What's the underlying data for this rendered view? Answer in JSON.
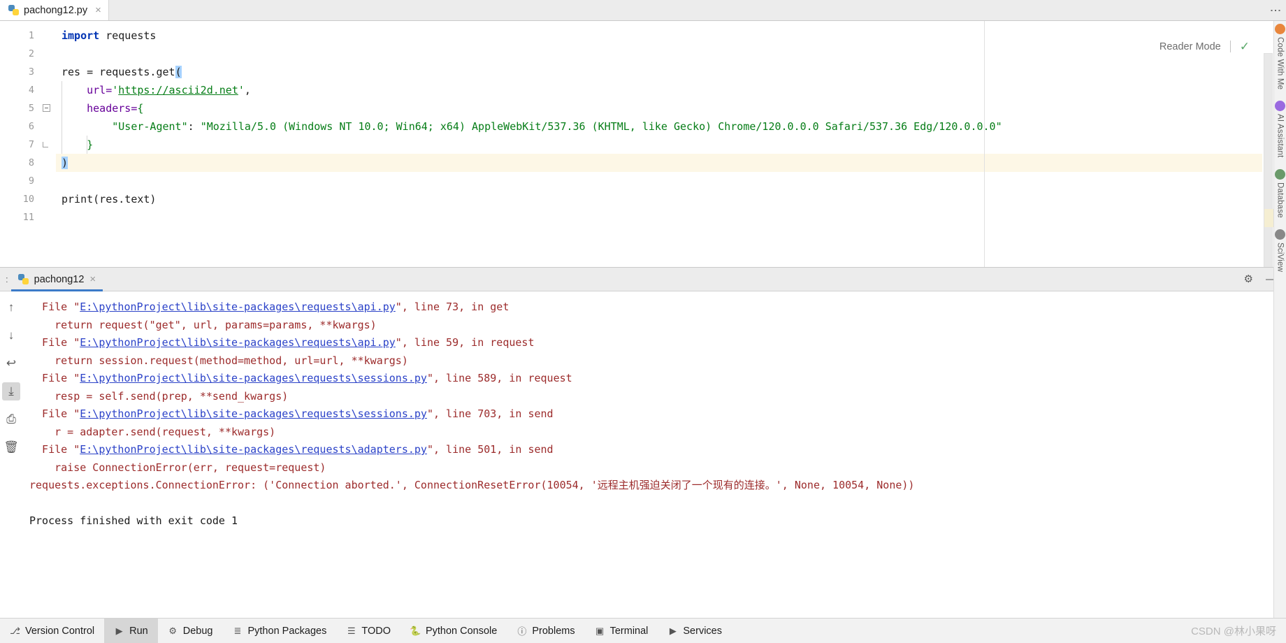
{
  "editor": {
    "tab": {
      "label": "pachong12.py",
      "icon": "python-file-icon",
      "close": "×"
    },
    "overflow_icon": "more-options-icon",
    "reader_mode": {
      "label": "Reader Mode",
      "check_icon": "checkmark-icon"
    },
    "line_numbers": [
      "1",
      "2",
      "3",
      "4",
      "5",
      "6",
      "7",
      "8",
      "9",
      "10",
      "11"
    ],
    "code_lines": [
      {
        "n": 1,
        "tokens": [
          {
            "t": "import ",
            "c": "k"
          },
          {
            "t": "requests",
            "c": "plain"
          }
        ]
      },
      {
        "n": 2,
        "tokens": []
      },
      {
        "n": 3,
        "tokens": [
          {
            "t": "res = requests.get",
            "c": "plain"
          },
          {
            "t": "(",
            "c": "sel-paren"
          }
        ]
      },
      {
        "n": 4,
        "tokens": [
          {
            "t": "    url=",
            "c": "param"
          },
          {
            "t": "'",
            "c": "str"
          },
          {
            "t": "https://ascii2d.net",
            "c": "url"
          },
          {
            "t": "'",
            "c": "str"
          },
          {
            "t": ",",
            "c": "plain"
          }
        ]
      },
      {
        "n": 5,
        "tokens": [
          {
            "t": "    headers=",
            "c": "param"
          },
          {
            "t": "{",
            "c": "brace"
          }
        ]
      },
      {
        "n": 6,
        "tokens": [
          {
            "t": "        \"User-Agent\"",
            "c": "str"
          },
          {
            "t": ": ",
            "c": "plain"
          },
          {
            "t": "\"Mozilla/5.0 (Windows NT 10.0; Win64; x64) AppleWebKit/537.36 (KHTML, like Gecko) Chrome/120.0.0.0 Safari/537.36 Edg/120.0.0.0\"",
            "c": "str"
          }
        ]
      },
      {
        "n": 7,
        "tokens": [
          {
            "t": "    }",
            "c": "brace"
          }
        ]
      },
      {
        "n": 8,
        "tokens": [
          {
            "t": ")",
            "c": "sel-paren"
          }
        ],
        "current": true
      },
      {
        "n": 9,
        "tokens": []
      },
      {
        "n": 10,
        "tokens": [
          {
            "t": "print",
            "c": "fn"
          },
          {
            "t": "(res.text)",
            "c": "plain"
          }
        ]
      },
      {
        "n": 11,
        "tokens": []
      }
    ]
  },
  "right_strip": {
    "items": [
      {
        "label": "Code With Me",
        "icon": "codewithme-icon"
      },
      {
        "label": "AI Assistant",
        "icon": "ai-assistant-icon"
      },
      {
        "label": "Database",
        "icon": "database-icon"
      },
      {
        "label": "SciView",
        "icon": "sciview-icon"
      }
    ]
  },
  "run_window": {
    "prefix": ":",
    "tab": {
      "label": "pachong12",
      "icon": "python-run-icon",
      "close": "×"
    },
    "settings_icon": "gear-icon",
    "minimize_icon": "minimize-icon",
    "sidebar_buttons": [
      {
        "name": "up-arrow-icon",
        "glyph": "↑"
      },
      {
        "name": "down-arrow-icon",
        "glyph": "↓"
      },
      {
        "name": "soft-wrap-icon",
        "glyph": "↩"
      },
      {
        "name": "scroll-to-end-icon",
        "glyph": "⤓",
        "selected": true
      },
      {
        "name": "print-icon",
        "glyph": "⎙"
      },
      {
        "name": "trash-icon",
        "glyph": "🗑"
      }
    ],
    "output": [
      {
        "parts": [
          {
            "t": "  File \"",
            "c": "err"
          },
          {
            "t": "E:\\pythonProject\\lib\\site-packages\\requests\\api.py",
            "c": "lnk"
          },
          {
            "t": "\", line 73, in get",
            "c": "err"
          }
        ]
      },
      {
        "parts": [
          {
            "t": "    return request(\"get\", url, params=params, **kwargs)",
            "c": "err"
          }
        ]
      },
      {
        "parts": [
          {
            "t": "  File \"",
            "c": "err"
          },
          {
            "t": "E:\\pythonProject\\lib\\site-packages\\requests\\api.py",
            "c": "lnk"
          },
          {
            "t": "\", line 59, in request",
            "c": "err"
          }
        ]
      },
      {
        "parts": [
          {
            "t": "    return session.request(method=method, url=url, **kwargs)",
            "c": "err"
          }
        ]
      },
      {
        "parts": [
          {
            "t": "  File \"",
            "c": "err"
          },
          {
            "t": "E:\\pythonProject\\lib\\site-packages\\requests\\sessions.py",
            "c": "lnk"
          },
          {
            "t": "\", line 589, in request",
            "c": "err"
          }
        ]
      },
      {
        "parts": [
          {
            "t": "    resp = self.send(prep, **send_kwargs)",
            "c": "err"
          }
        ]
      },
      {
        "parts": [
          {
            "t": "  File \"",
            "c": "err"
          },
          {
            "t": "E:\\pythonProject\\lib\\site-packages\\requests\\sessions.py",
            "c": "lnk"
          },
          {
            "t": "\", line 703, in send",
            "c": "err"
          }
        ]
      },
      {
        "parts": [
          {
            "t": "    r = adapter.send(request, **kwargs)",
            "c": "err"
          }
        ]
      },
      {
        "parts": [
          {
            "t": "  File \"",
            "c": "err"
          },
          {
            "t": "E:\\pythonProject\\lib\\site-packages\\requests\\adapters.py",
            "c": "lnk"
          },
          {
            "t": "\", line 501, in send",
            "c": "err"
          }
        ]
      },
      {
        "parts": [
          {
            "t": "    raise ConnectionError(err, request=request)",
            "c": "err"
          }
        ]
      },
      {
        "parts": [
          {
            "t": "requests.exceptions.ConnectionError: ('Connection aborted.', ConnectionResetError(10054, '远程主机强迫关闭了一个现有的连接。', None, 10054, None))",
            "c": "err"
          }
        ]
      },
      {
        "parts": []
      },
      {
        "parts": [
          {
            "t": "Process finished with exit code 1",
            "c": "fin"
          }
        ]
      }
    ]
  },
  "statusbar": {
    "items": [
      {
        "label": "Version Control",
        "icon": "version-control-icon",
        "active": false
      },
      {
        "label": "Run",
        "icon": "run-play-icon",
        "active": true
      },
      {
        "label": "Debug",
        "icon": "debug-bug-icon",
        "active": false
      },
      {
        "label": "Python Packages",
        "icon": "packages-icon",
        "active": false
      },
      {
        "label": "TODO",
        "icon": "todo-list-icon",
        "active": false
      },
      {
        "label": "Python Console",
        "icon": "python-console-icon",
        "active": false
      },
      {
        "label": "Problems",
        "icon": "problems-icon",
        "active": false
      },
      {
        "label": "Terminal",
        "icon": "terminal-icon",
        "active": false
      },
      {
        "label": "Services",
        "icon": "services-icon",
        "active": false
      }
    ],
    "watermark": "CSDN @林小果呀"
  },
  "colors": {
    "accent": "#3c7bc8",
    "error": "#9c2b2b",
    "link": "#2b42c8",
    "string": "#067d17",
    "keyword": "#0033b3",
    "param": "#660099",
    "current_line": "#fdf7e6"
  }
}
